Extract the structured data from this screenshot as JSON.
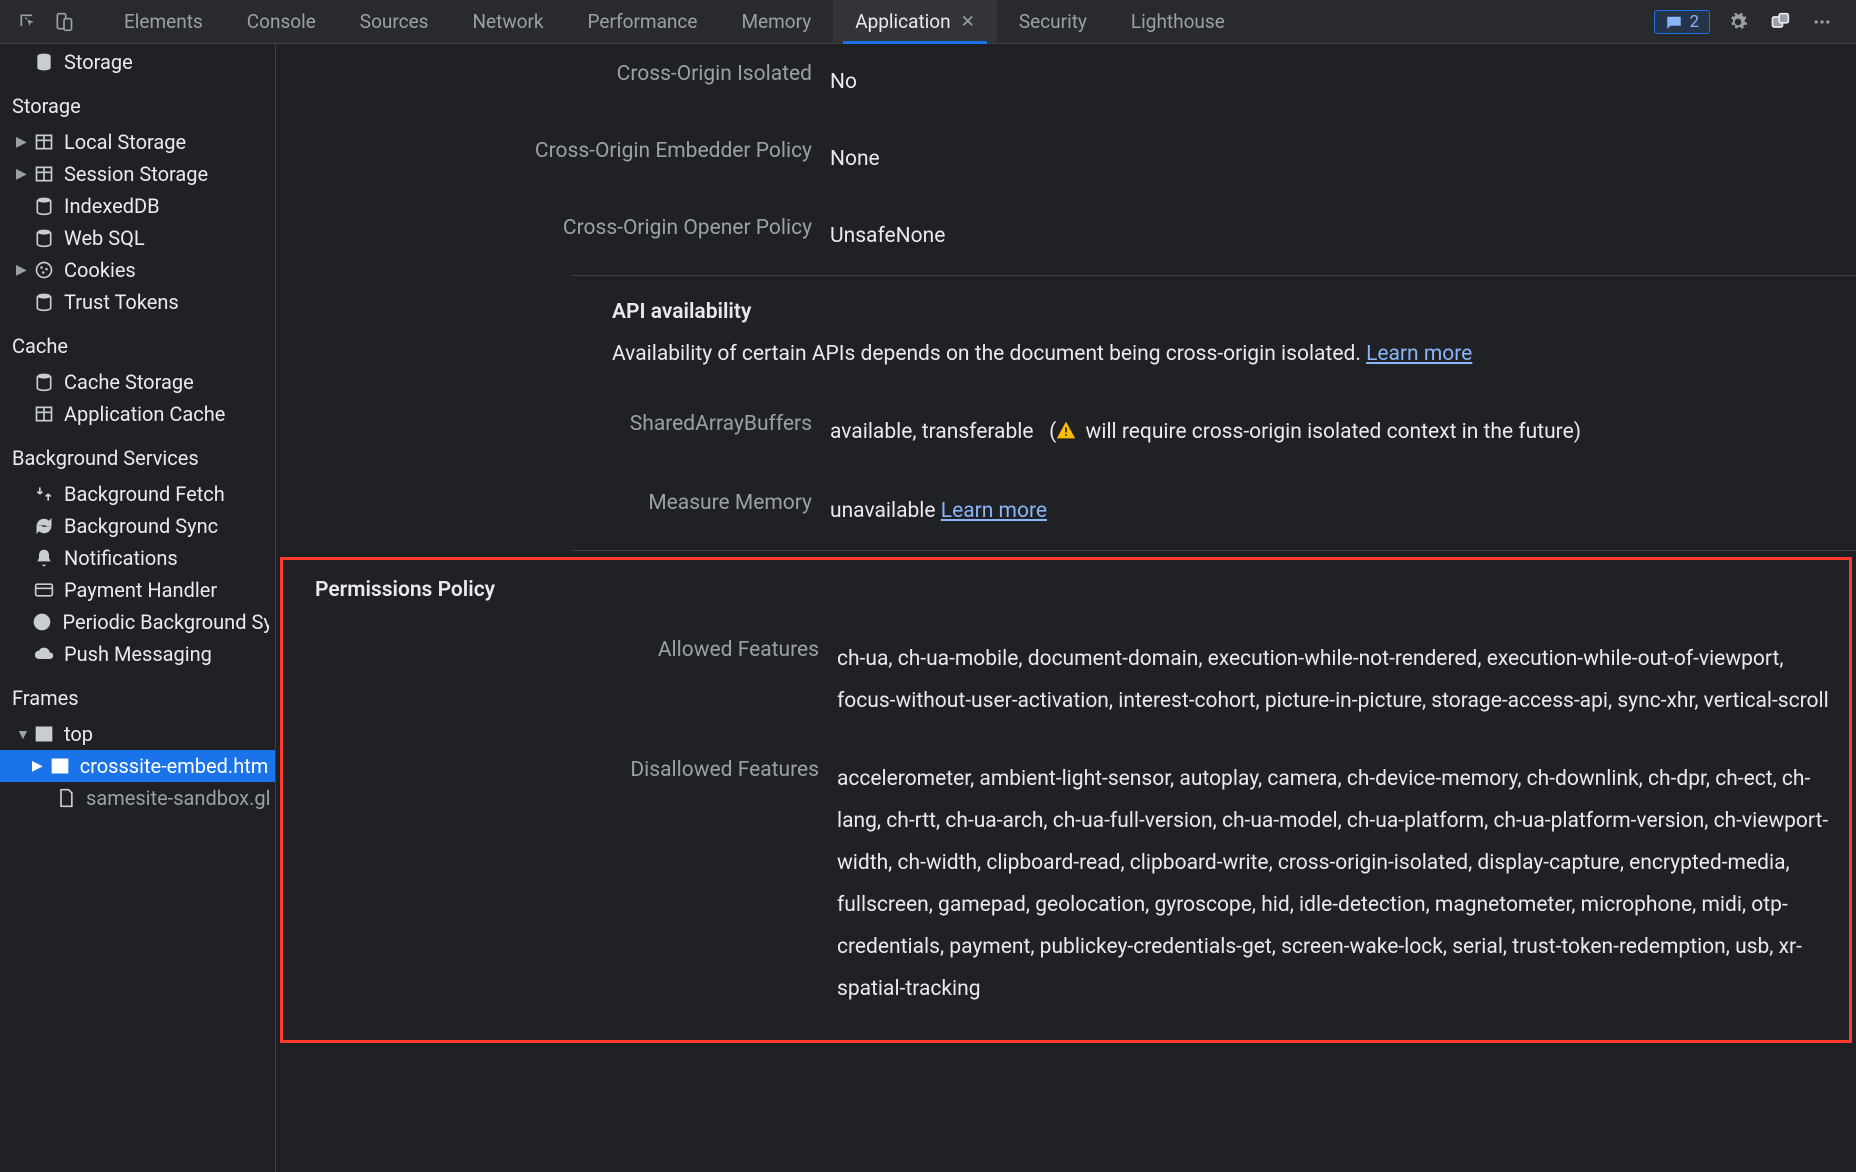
{
  "tabs": [
    "Elements",
    "Console",
    "Sources",
    "Network",
    "Performance",
    "Memory",
    "Application",
    "Security",
    "Lighthouse"
  ],
  "activeTab": "Application",
  "issueBadge": "2",
  "sidebar": {
    "application": {
      "storageLabel": "Storage"
    },
    "storage": {
      "header": "Storage",
      "items": [
        "Local Storage",
        "Session Storage",
        "IndexedDB",
        "Web SQL",
        "Cookies",
        "Trust Tokens"
      ]
    },
    "cache": {
      "header": "Cache",
      "items": [
        "Cache Storage",
        "Application Cache"
      ]
    },
    "bg": {
      "header": "Background Services",
      "items": [
        "Background Fetch",
        "Background Sync",
        "Notifications",
        "Payment Handler",
        "Periodic Background Sync",
        "Push Messaging"
      ]
    },
    "frames": {
      "header": "Frames",
      "top": "top",
      "child1": "crosssite-embed.html",
      "child2": "samesite-sandbox.glitch"
    }
  },
  "securityIsolation": {
    "rows": [
      {
        "label": "Cross-Origin Isolated",
        "value": "No"
      },
      {
        "label": "Cross-Origin Embedder Policy",
        "value": "None"
      },
      {
        "label": "Cross-Origin Opener Policy",
        "value": "UnsafeNone"
      }
    ]
  },
  "apiAvailability": {
    "title": "API availability",
    "desc": "Availability of certain APIs depends on the document being cross-origin isolated. ",
    "learnMore": "Learn more",
    "sab": {
      "label": "SharedArrayBuffers",
      "value": "available, transferable",
      "extra": " will require cross-origin isolated context in the future)"
    },
    "mm": {
      "label": "Measure Memory",
      "value": "unavailable ",
      "link": "Learn more"
    }
  },
  "permissionsPolicy": {
    "title": "Permissions Policy",
    "allowedLabel": "Allowed Features",
    "allowed": "ch-ua, ch-ua-mobile, document-domain, execution-while-not-rendered, execution-while-out-of-viewport, focus-without-user-activation, interest-cohort, picture-in-picture, storage-access-api, sync-xhr, vertical-scroll",
    "disallowedLabel": "Disallowed Features",
    "disallowed": "accelerometer, ambient-light-sensor, autoplay, camera, ch-device-memory, ch-downlink, ch-dpr, ch-ect, ch-lang, ch-rtt, ch-ua-arch, ch-ua-full-version, ch-ua-model, ch-ua-platform, ch-ua-platform-version, ch-viewport-width, ch-width, clipboard-read, clipboard-write, cross-origin-isolated, display-capture, encrypted-media, fullscreen, gamepad, geolocation, gyroscope, hid, idle-detection, magnetometer, microphone, midi, otp-credentials, payment, publickey-credentials-get, screen-wake-lock, serial, trust-token-redemption, usb, xr-spatial-tracking"
  }
}
